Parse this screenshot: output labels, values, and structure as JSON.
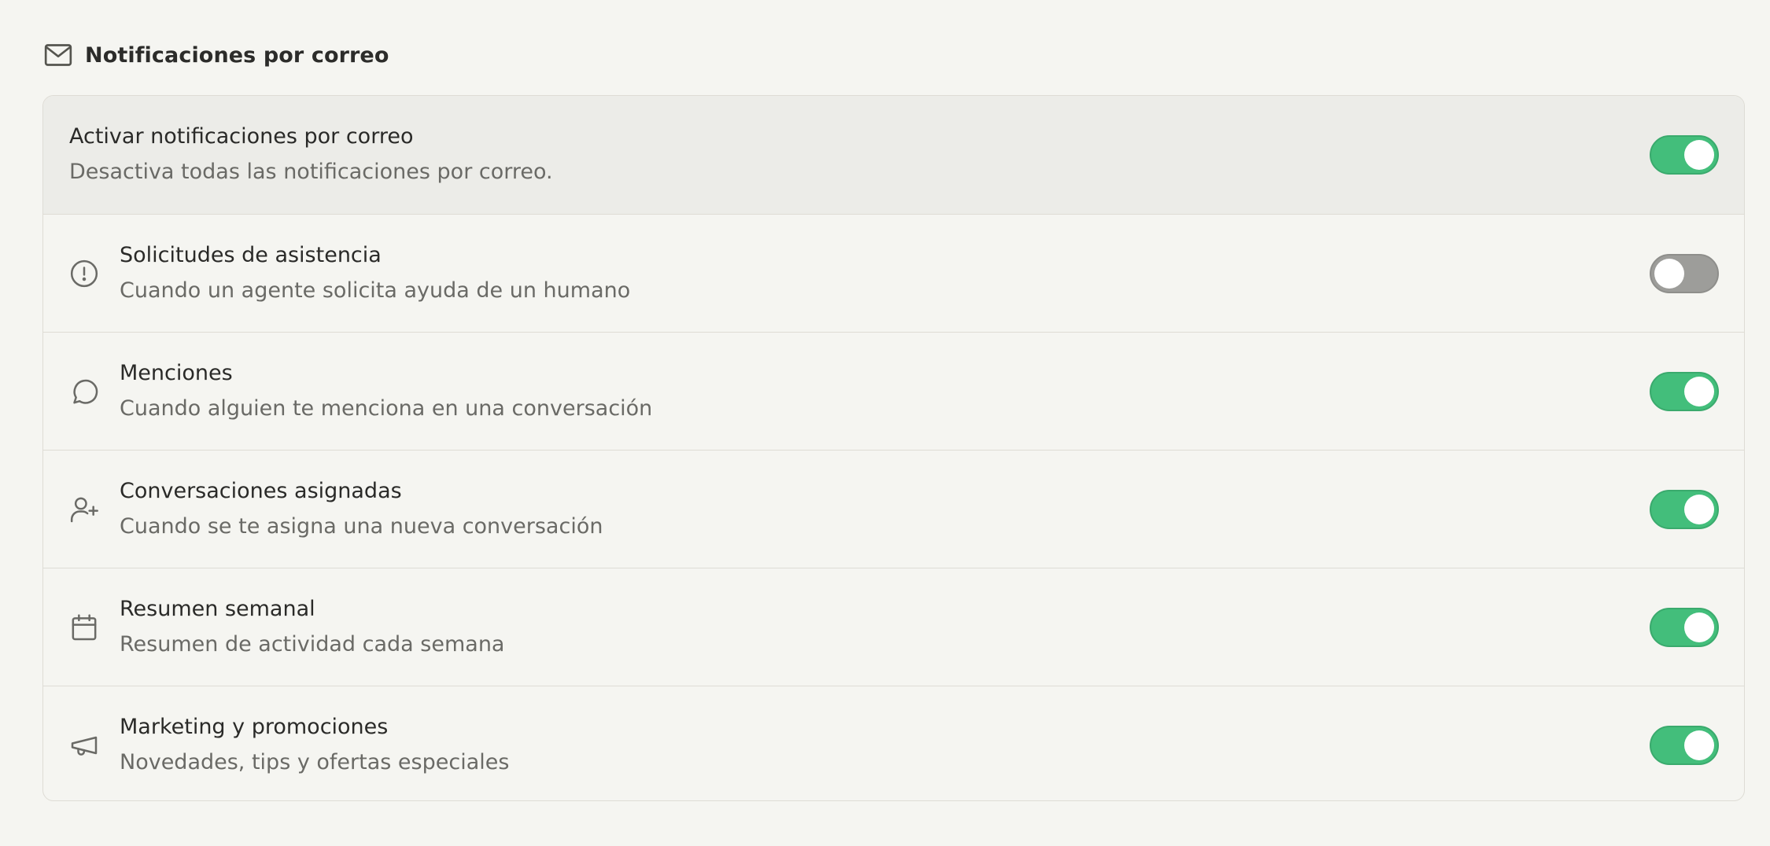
{
  "section": {
    "title": "Notificaciones por correo",
    "icon": "mail-icon"
  },
  "master": {
    "title": "Activar notificaciones por correo",
    "description": "Desactiva todas las notificaciones por correo.",
    "enabled": true
  },
  "items": [
    {
      "key": "support",
      "icon": "alert-circle-icon",
      "title": "Solicitudes de asistencia",
      "description": "Cuando un agente solicita ayuda de un humano",
      "enabled": false
    },
    {
      "key": "mentions",
      "icon": "message-circle-icon",
      "title": "Menciones",
      "description": "Cuando alguien te menciona en una conversación",
      "enabled": true
    },
    {
      "key": "assigned",
      "icon": "user-plus-icon",
      "title": "Conversaciones asignadas",
      "description": "Cuando se te asigna una nueva conversación",
      "enabled": true
    },
    {
      "key": "weekly",
      "icon": "calendar-icon",
      "title": "Resumen semanal",
      "description": "Resumen de actividad cada semana",
      "enabled": true
    },
    {
      "key": "marketing",
      "icon": "megaphone-icon",
      "title": "Marketing y promociones",
      "description": "Novedades, tips y ofertas especiales",
      "enabled": true
    }
  ],
  "colors": {
    "toggle_on": "#43be7b",
    "toggle_off": "#9d9d9a",
    "background": "#f5f5f1",
    "master_row_bg": "#ecece8"
  }
}
